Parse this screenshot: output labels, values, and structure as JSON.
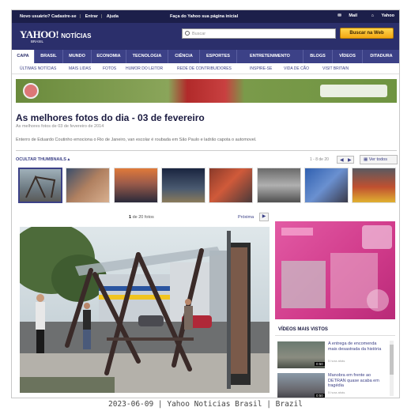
{
  "utility": {
    "new_user": "Novo usuário? Cadastre-se",
    "login": "Entrar",
    "help": "Ajuda",
    "homepage": "Faça do Yahoo sua página inicial",
    "mail": "Mail",
    "yahoo": "Yahoo"
  },
  "header": {
    "brand": "YAHOO!",
    "section": "NOTÍCIAS",
    "country": "BRASIL",
    "search_placeholder": "Buscar",
    "search_button": "Buscar na Web"
  },
  "nav": {
    "items": [
      "CAPA",
      "BRASIL",
      "MUNDO",
      "ECONOMIA",
      "TECNOLOGIA",
      "CIÊNCIA",
      "ESPORTES",
      "ENTRETENIMENTO",
      "BLOGS",
      "VÍDEOS",
      "DITADURA"
    ],
    "active": "CAPA"
  },
  "subnav": {
    "items": [
      "ÚLTIMAS NOTÍCIAS",
      "MAIS LIDAS",
      "FOTOS",
      "HUMOR DO LEITOR",
      "REDE DE CONTRIBUIDORES",
      "INSPIRE-SE",
      "VIDA DE CÃO",
      "VISIT BRITAIN"
    ]
  },
  "gallery": {
    "title": "As melhores fotos do dia - 03 de fevereiro",
    "subtitle": "As melhores fotos de 03 de fevereiro de 2014",
    "description": "Enterro de Eduardo Coutinho emociona o Rio de Janeiro, van escolar é roubada em São Paulo e ladrão capota o automovel.",
    "hide_thumbs": "OCULTAR THUMBNAILS",
    "thumb_counter": "1 - 8 de 20",
    "view_all": "Ver todos",
    "pager_current": "1",
    "pager_total": "de 20 fotos",
    "next": "Próxima"
  },
  "sidebar": {
    "videos_heading": "VÍDEOS MAIS VISTOS",
    "videos": [
      {
        "title": "A entrega de encomenda mais desastrada da história",
        "meta": "5 hora atrás",
        "duration": "0:50"
      },
      {
        "title": "Manobra em frente ao DETRAN quase acaba em tragédia",
        "meta": "5 hora atrás",
        "duration": "0:50"
      }
    ]
  },
  "caption": "2023-06-09 | Yahoo Noticias Brasil | Brazil",
  "colors": {
    "header_bg": "#2b2f6b",
    "nav_bg": "#3c4187",
    "search_button": "#f2a712",
    "ad_pink": "#d03a8a"
  }
}
